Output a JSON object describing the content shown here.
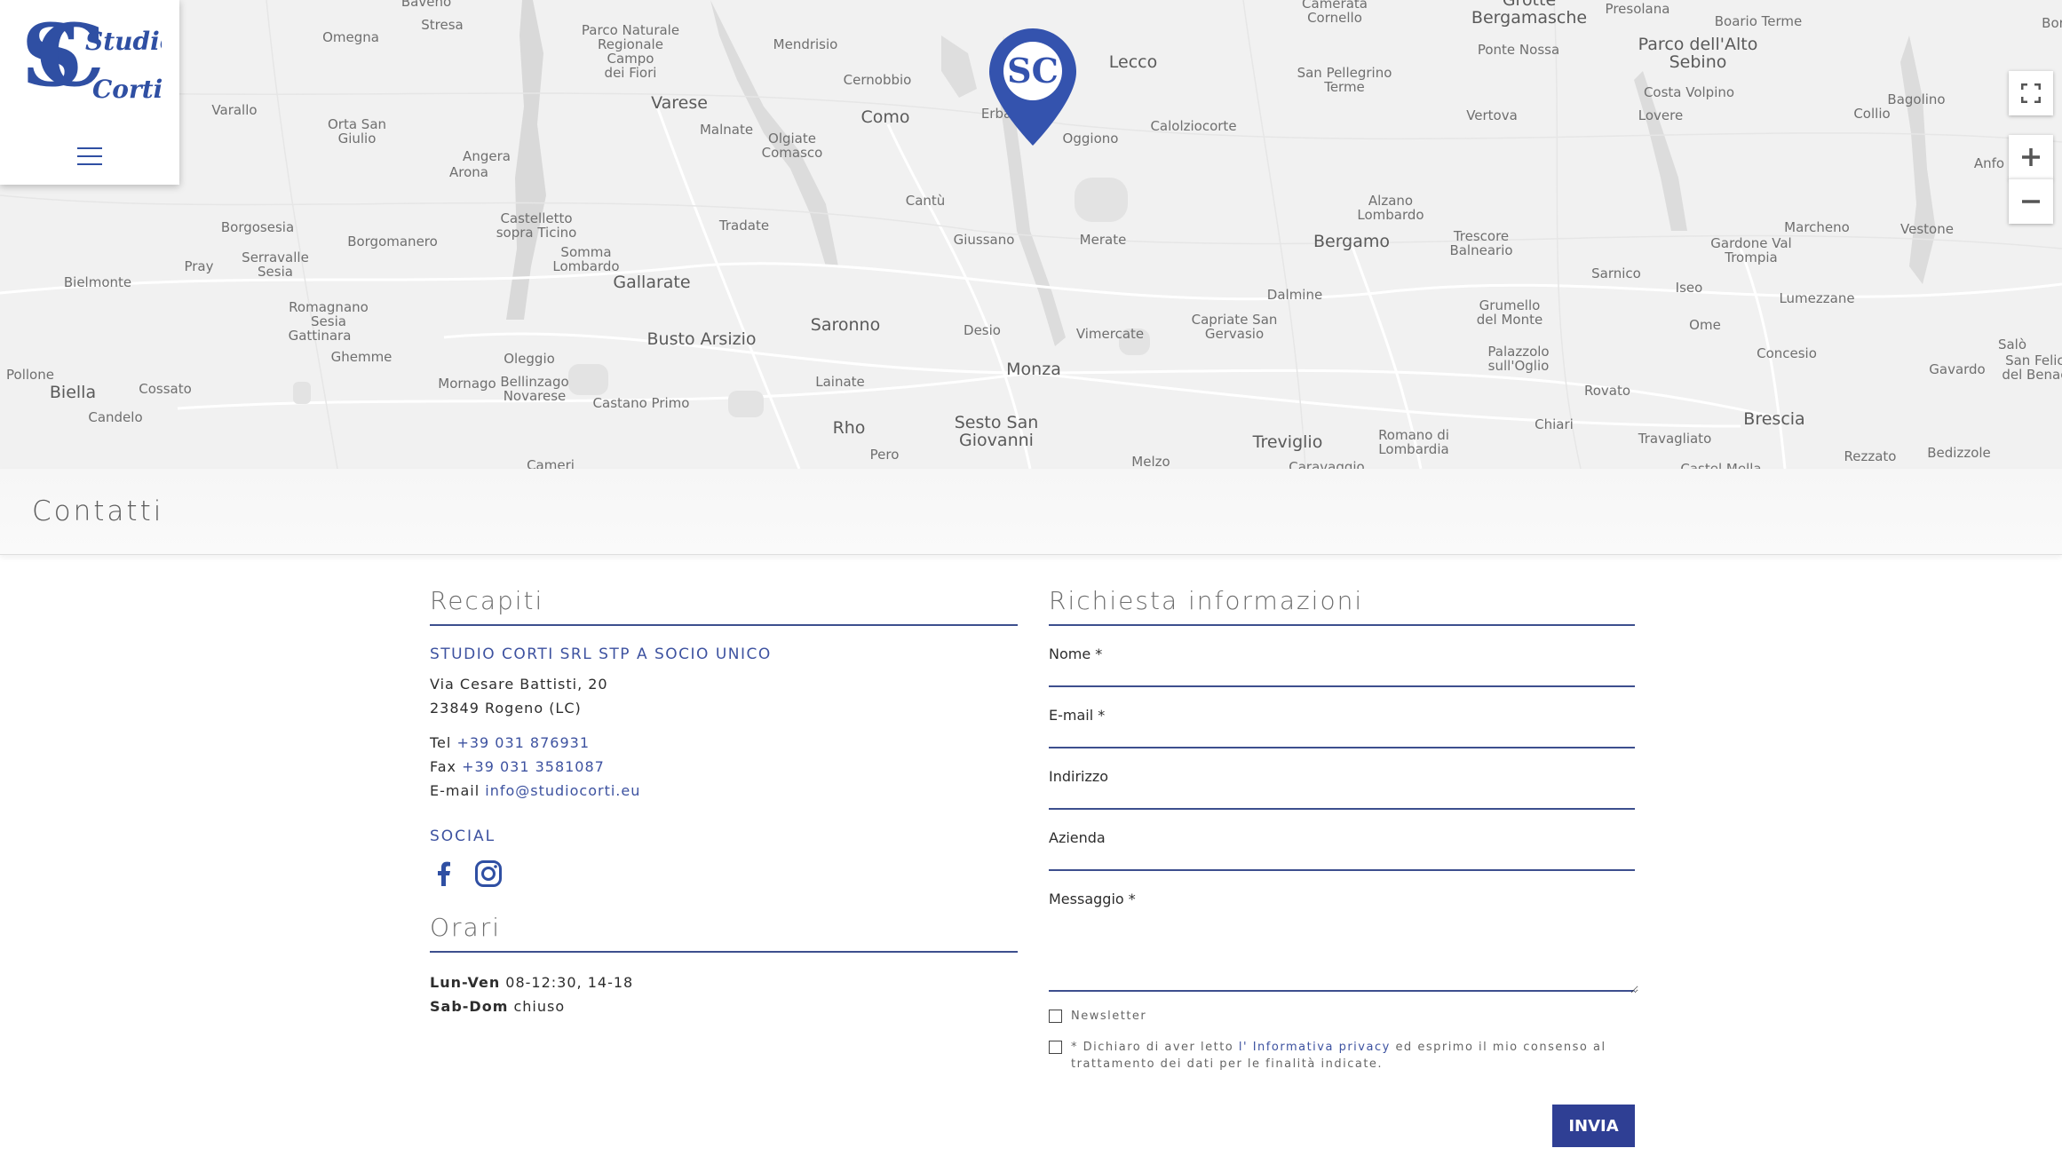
{
  "map": {
    "places": [
      {
        "name": "Baveno",
        "big": false
      },
      {
        "name": "Stresa",
        "big": false
      },
      {
        "name": "Omegna",
        "big": false
      },
      {
        "name": "Parco Naturale\nRegionale\nCampo\ndei Fiori",
        "big": false
      },
      {
        "name": "Mendrisio",
        "big": false
      },
      {
        "name": "Cernobbio",
        "big": false
      },
      {
        "name": "Lecco",
        "big": false
      },
      {
        "name": "Camerata\nCornello",
        "big": false
      },
      {
        "name": "Grotte\nBergamasche",
        "big": false
      },
      {
        "name": "Presolana",
        "big": false
      },
      {
        "name": "Boario Terme",
        "big": false
      },
      {
        "name": "Bor",
        "big": false
      },
      {
        "name": "Ponte Nossa",
        "big": false
      },
      {
        "name": "Parco dell'Alto\nSebino",
        "big": false
      },
      {
        "name": "San Pellegrino\nTerme",
        "big": false
      },
      {
        "name": "Costa Volpino",
        "big": false
      },
      {
        "name": "Bagolino",
        "big": false
      },
      {
        "name": "Varallo",
        "big": false
      },
      {
        "name": "Orta San\nGiulio",
        "big": false
      },
      {
        "name": "Varese",
        "big": true
      },
      {
        "name": "Malnate",
        "big": false
      },
      {
        "name": "Olgiate\nComasco",
        "big": false
      },
      {
        "name": "Como",
        "big": true
      },
      {
        "name": "Erba",
        "big": false
      },
      {
        "name": "Oggiono",
        "big": false
      },
      {
        "name": "Calolziocorte",
        "big": false
      },
      {
        "name": "Vertova",
        "big": false
      },
      {
        "name": "Lovere",
        "big": false
      },
      {
        "name": "Collio",
        "big": false
      },
      {
        "name": "Anfo",
        "big": false
      },
      {
        "name": "Angera",
        "big": false
      },
      {
        "name": "Arona",
        "big": false
      },
      {
        "name": "Cantù",
        "big": false
      },
      {
        "name": "Alzano\nLombardo",
        "big": false
      },
      {
        "name": "Marcheno",
        "big": false
      },
      {
        "name": "Vestone",
        "big": false
      },
      {
        "name": "Borgosesia",
        "big": false
      },
      {
        "name": "Castelletto\nsopra Ticino",
        "big": false
      },
      {
        "name": "Tradate",
        "big": false
      },
      {
        "name": "Giussano",
        "big": false
      },
      {
        "name": "Merate",
        "big": false
      },
      {
        "name": "Bergamo",
        "big": true
      },
      {
        "name": "Trescore\nBalneario",
        "big": false
      },
      {
        "name": "Gardone Val\nTrompia",
        "big": false
      },
      {
        "name": "Borgomanero",
        "big": false
      },
      {
        "name": "Serravalle\nSesia",
        "big": false
      },
      {
        "name": "Pray",
        "big": false
      },
      {
        "name": "Somma\nLombardo",
        "big": false
      },
      {
        "name": "Gallarate",
        "big": true
      },
      {
        "name": "Bielmonte",
        "big": false
      },
      {
        "name": "Sarnico",
        "big": false
      },
      {
        "name": "Iseo",
        "big": false
      },
      {
        "name": "Dalmine",
        "big": false
      },
      {
        "name": "Lumezzane",
        "big": false
      },
      {
        "name": "Romagnano\nSesia",
        "big": false
      },
      {
        "name": "Gattinara",
        "big": false
      },
      {
        "name": "Saronno",
        "big": true
      },
      {
        "name": "Capriate San\nGervasio",
        "big": false
      },
      {
        "name": "Grumello\ndel Monte",
        "big": false
      },
      {
        "name": "Ome",
        "big": false
      },
      {
        "name": "Desio",
        "big": false
      },
      {
        "name": "Vimercate",
        "big": false
      },
      {
        "name": "Busto Arsizio",
        "big": true
      },
      {
        "name": "Salò",
        "big": false
      },
      {
        "name": "Ghemme",
        "big": false
      },
      {
        "name": "Oleggio",
        "big": false
      },
      {
        "name": "Concesio",
        "big": false
      },
      {
        "name": "Monza",
        "big": true
      },
      {
        "name": "Palazzolo\nsull'Oglio",
        "big": false
      },
      {
        "name": "Pollone",
        "big": false
      },
      {
        "name": "Gavardo",
        "big": false
      },
      {
        "name": "San Felice\ndel Benaco",
        "big": false
      },
      {
        "name": "Mornago",
        "big": false
      },
      {
        "name": "Bellinzago\nNovarese",
        "big": false
      },
      {
        "name": "Lainate",
        "big": false
      },
      {
        "name": "Cossato",
        "big": false
      },
      {
        "name": "Biella",
        "big": true
      },
      {
        "name": "Rovato",
        "big": false
      },
      {
        "name": "Castano Primo",
        "big": false
      },
      {
        "name": "Candelo",
        "big": false
      },
      {
        "name": "Rho",
        "big": true
      },
      {
        "name": "Sesto San\nGiovanni",
        "big": true
      },
      {
        "name": "Chiari",
        "big": false
      },
      {
        "name": "Brescia",
        "big": true
      },
      {
        "name": "Treviglio",
        "big": true
      },
      {
        "name": "Romano di\nLombardia",
        "big": false
      },
      {
        "name": "Travagliato",
        "big": false
      },
      {
        "name": "Rezzato",
        "big": false
      },
      {
        "name": "Bedizzole",
        "big": false
      },
      {
        "name": "Cameri",
        "big": false
      },
      {
        "name": "Pero",
        "big": false
      },
      {
        "name": "Melzo",
        "big": false
      },
      {
        "name": "Caravaggio",
        "big": false
      },
      {
        "name": "Castel Mella",
        "big": false
      }
    ],
    "pin_text": "SC",
    "controls": {
      "fullscreen": "fullscreen-icon",
      "zoom_in": "+",
      "zoom_out": "−"
    }
  },
  "logo": {
    "line1": "Studio",
    "line2": "Corti",
    "mono": "SC"
  },
  "page_title": "Contatti",
  "recapiti": {
    "title": "Recapiti",
    "company": "STUDIO CORTI SRL STP A SOCIO UNICO",
    "address1": "Via Cesare Battisti, 20",
    "address2": "23849 Rogeno (LC)",
    "tel_label": "Tel",
    "tel": "+39 031 876931",
    "fax_label": "Fax",
    "fax": "+39 031 3581087",
    "email_label": "E-mail",
    "email": "info@studiocorti.eu",
    "social_title": "SOCIAL"
  },
  "orari": {
    "title": "Orari",
    "row1_day": "Lun-Ven",
    "row1_time": "08-12:30, 14-18",
    "row2_day": "Sab-Dom",
    "row2_time": "chiuso"
  },
  "form": {
    "title": "Richiesta informazioni",
    "nome": "Nome *",
    "email": "E-mail *",
    "indirizzo": "Indirizzo",
    "azienda": "Azienda",
    "messaggio": "Messaggio *",
    "newsletter": "Newsletter",
    "privacy_pre": "* Dichiaro di aver letto",
    "privacy_link": "l' Informativa privacy",
    "privacy_post": "ed esprimo il mio consenso al trattamento dei dati per le finalità indicate.",
    "submit": "INVIA"
  },
  "colors": {
    "accent": "#2f3f94",
    "link": "#3d52a0",
    "map_bg": "#f1f1f1"
  }
}
